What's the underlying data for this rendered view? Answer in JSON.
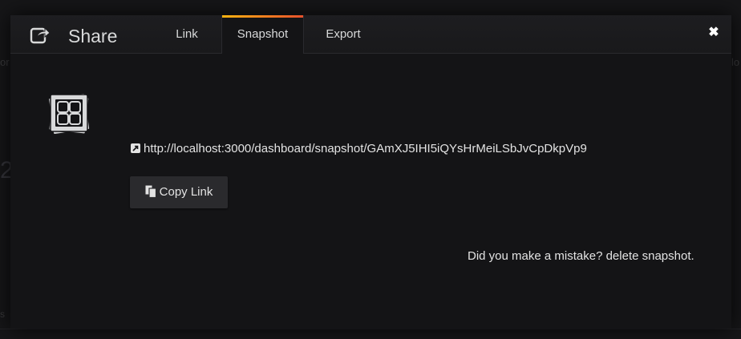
{
  "modal": {
    "title": "Share",
    "tabs": [
      {
        "label": "Link",
        "active": false
      },
      {
        "label": "Snapshot",
        "active": true
      },
      {
        "label": "Export",
        "active": false
      }
    ],
    "close_glyph": "✖"
  },
  "snapshot": {
    "url": "http://localhost:3000/dashboard/snapshot/GAmXJ5IHI5iQYsHrMeiLSbJvCpDkpVp9",
    "copy_button_label": "Copy Link",
    "delete_prompt": "Did you make a mistake? ",
    "delete_link_label": "delete snapshot."
  },
  "icons": {
    "header": "share-icon",
    "snapshot": "snapshot-images-icon",
    "url": "external-link-icon",
    "copy": "copy-icon",
    "close": "close-icon"
  },
  "colors": {
    "active_tab_gradient_start": "#fbb311",
    "active_tab_gradient_end": "#e6512c",
    "modal_background": "#141416",
    "text": "#d8d9da"
  }
}
